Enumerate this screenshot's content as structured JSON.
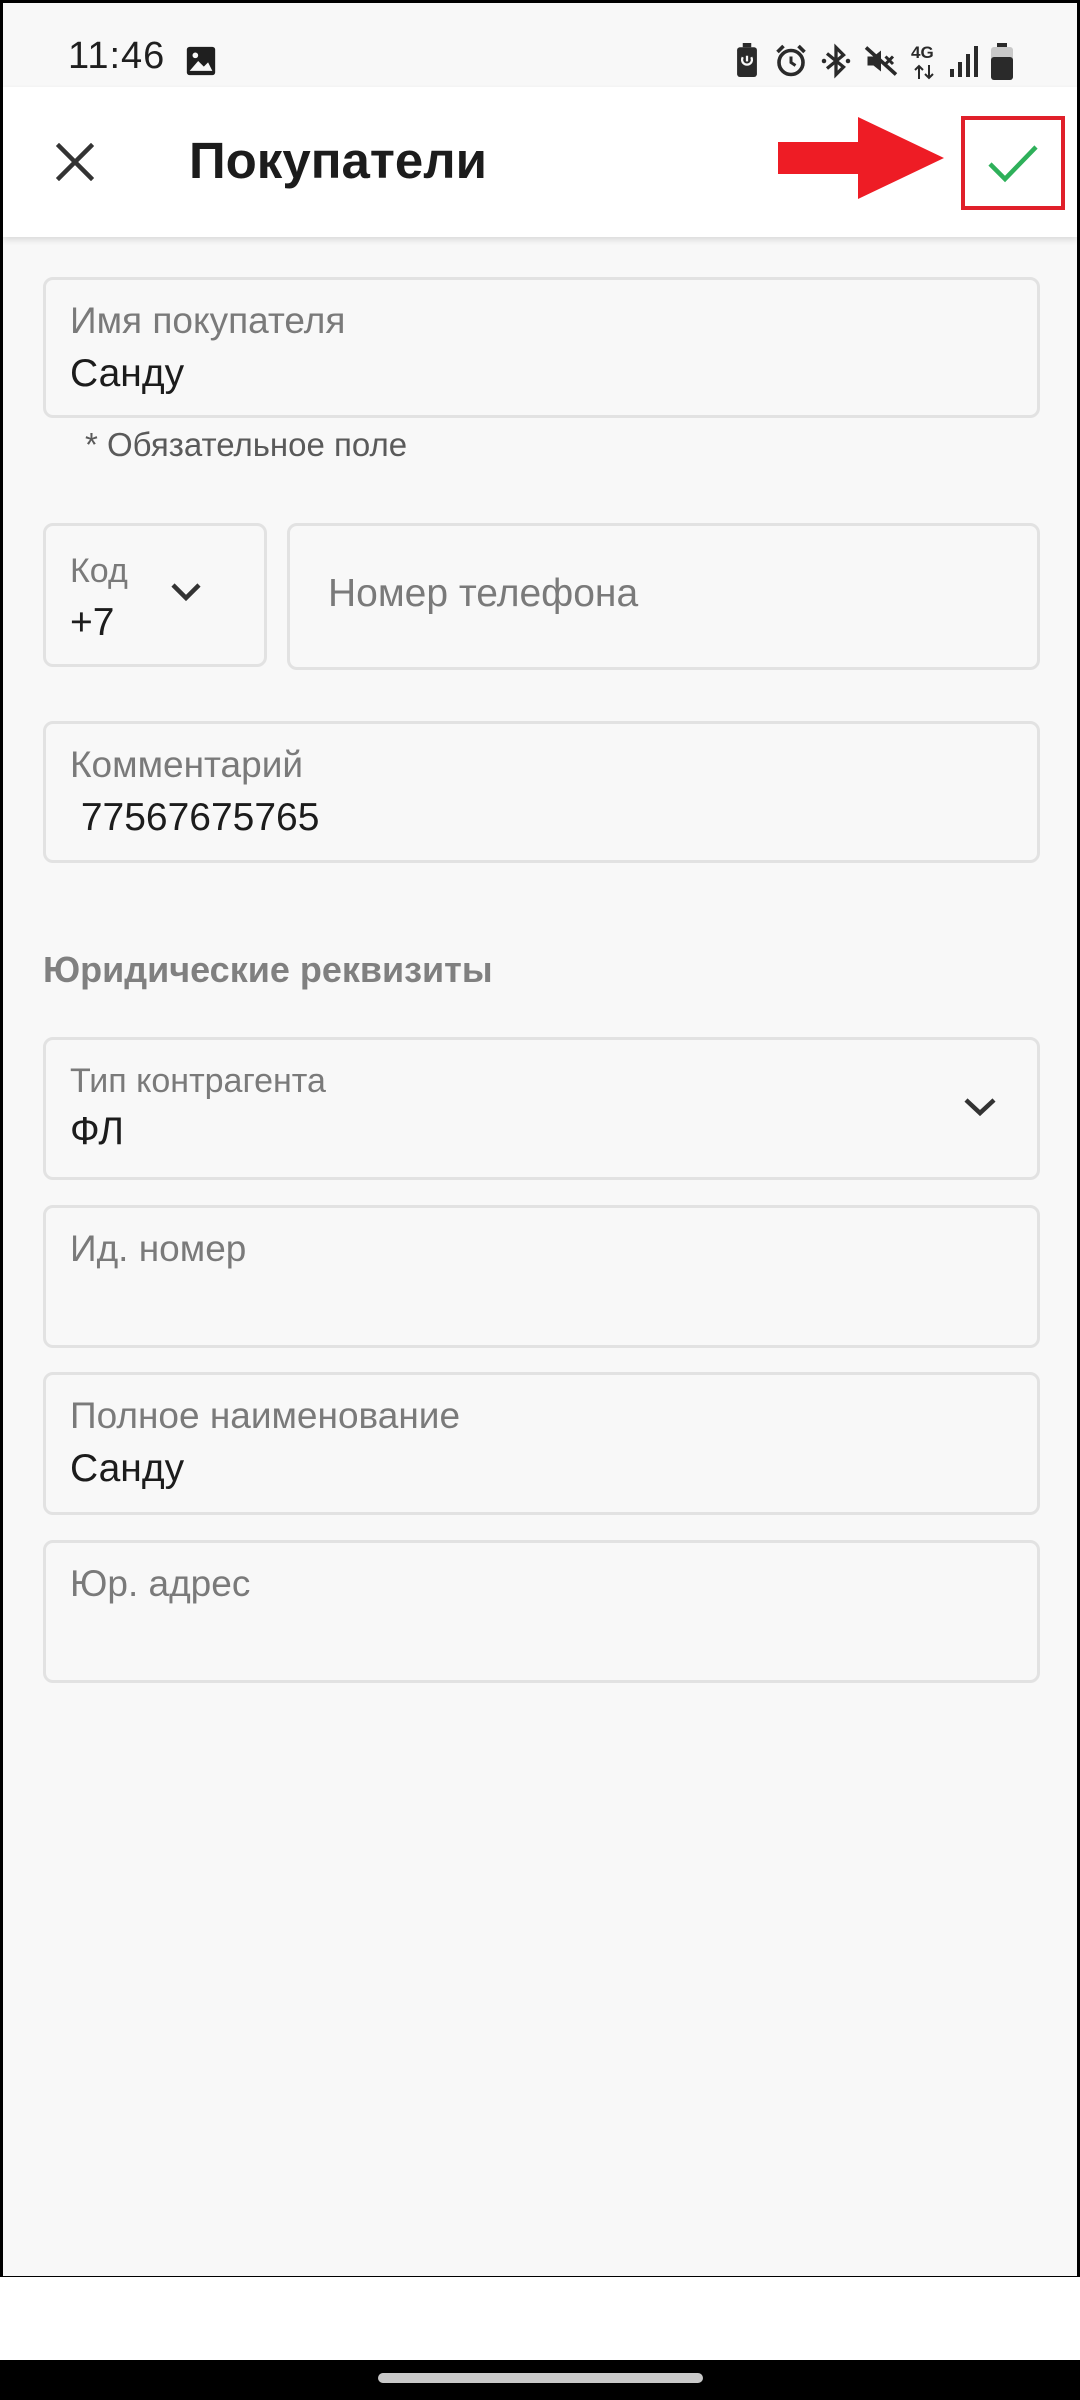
{
  "status_bar": {
    "time": "11:46",
    "network": "4G",
    "icons": [
      "image-icon",
      "battery-saver-icon",
      "alarm-icon",
      "bluetooth-icon",
      "vibrate-off-icon",
      "network-4g-icon",
      "signal-icon",
      "battery-icon"
    ]
  },
  "app_bar": {
    "title": "Покупатели",
    "close_icon": "close-icon",
    "confirm_icon": "check-icon",
    "confirm_color": "#2eb05a",
    "annotation_color": "#e0202a"
  },
  "form": {
    "customer_name": {
      "label": "Имя покупателя",
      "value": "Санду",
      "helper": "* Обязательное поле"
    },
    "phone_code": {
      "label": "Код",
      "value": "+7"
    },
    "phone_number": {
      "placeholder": "Номер телефона"
    },
    "comment": {
      "label": "Комментарий",
      "value": " 77567675765"
    }
  },
  "legal": {
    "section_title": "Юридические реквизиты",
    "counterparty_type": {
      "label": "Тип контрагента",
      "value": "ФЛ"
    },
    "id_number": {
      "label": "Ид. номер",
      "value": ""
    },
    "full_name": {
      "label": "Полное наименование",
      "value": "Санду"
    },
    "legal_address": {
      "label": "Юр. адрес",
      "value": ""
    }
  }
}
